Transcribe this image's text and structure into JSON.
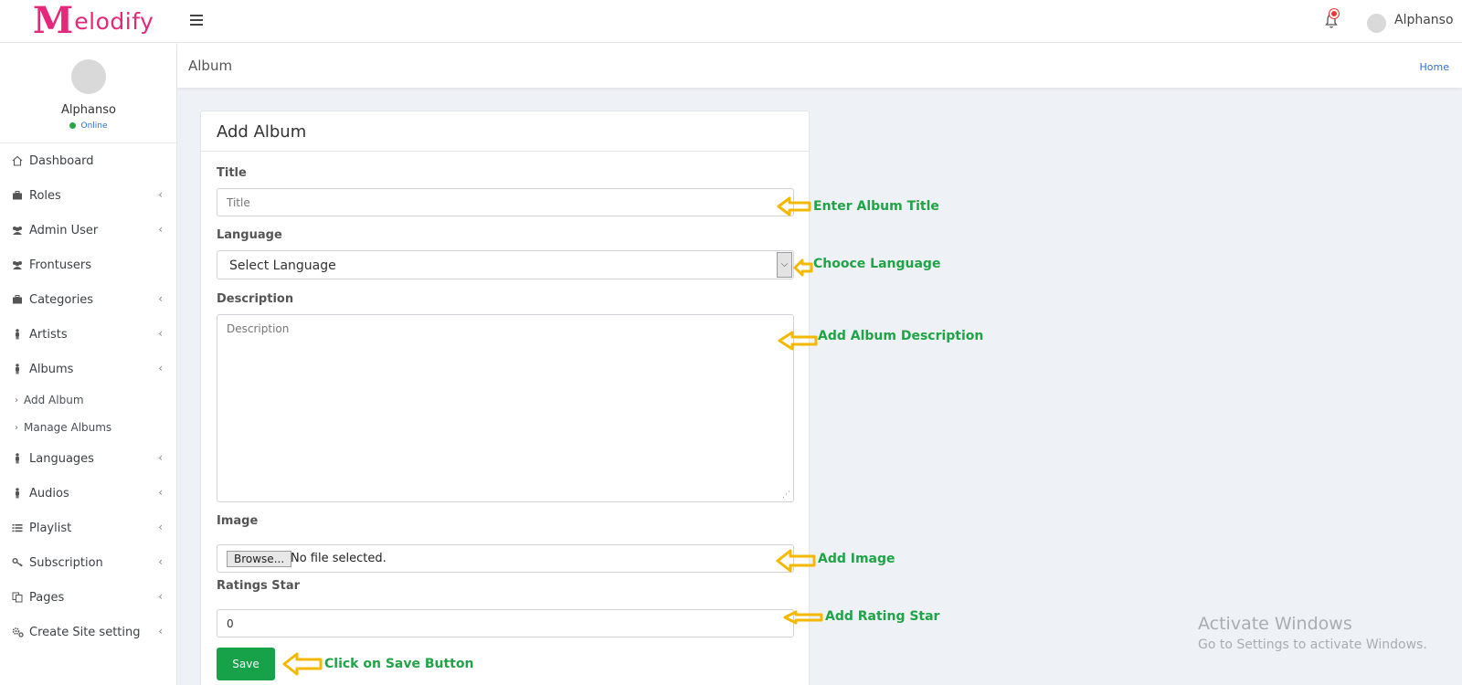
{
  "header": {
    "logo_first": "M",
    "logo_rest": "elodify",
    "user_name": "Alphanso"
  },
  "sidebar": {
    "profile_name": "Alphanso",
    "profile_status": "Online",
    "items": [
      {
        "label": "Dashboard",
        "icon": "home-icon"
      },
      {
        "label": "Roles",
        "icon": "briefcase-icon"
      },
      {
        "label": "Admin User",
        "icon": "users-icon"
      },
      {
        "label": "Frontusers",
        "icon": "users-icon"
      },
      {
        "label": "Categories",
        "icon": "briefcase-icon"
      },
      {
        "label": "Artists",
        "icon": "person-icon"
      },
      {
        "label": "Albums",
        "icon": "person-icon"
      },
      {
        "label": "Languages",
        "icon": "person-icon"
      },
      {
        "label": "Audios",
        "icon": "person-icon"
      },
      {
        "label": "Playlist",
        "icon": "list-icon"
      },
      {
        "label": "Subscription",
        "icon": "key-icon"
      },
      {
        "label": "Pages",
        "icon": "copy-icon"
      },
      {
        "label": "Create Site setting",
        "icon": "gears-icon"
      }
    ],
    "albums_sub": [
      "Add Album",
      "Manage Albums"
    ]
  },
  "content_header": {
    "title": "Album",
    "breadcrumb": "Home"
  },
  "form": {
    "card_title": "Add Album",
    "title_label": "Title",
    "title_placeholder": "Title",
    "language_label": "Language",
    "language_value": "Select Language",
    "description_label": "Description",
    "description_placeholder": "Description",
    "image_label": "Image",
    "browse_label": "Browse...",
    "no_file": "No file selected.",
    "ratings_label": "Ratings Star",
    "ratings_value": "0",
    "save_label": "Save"
  },
  "annotations": {
    "title": "Enter Album Title",
    "language": "Chooce Language",
    "description": "Add Album Description",
    "image": "Add Image",
    "rating": "Add Rating Star",
    "save": "Click on Save Button"
  },
  "colors": {
    "brand": "#e6287a",
    "save_button": "#17a24a",
    "annotation_text": "#21a347",
    "annotation_arrow": "#f5b800",
    "link": "#2f6fcf"
  },
  "watermark": {
    "line1": "Activate Windows",
    "line2": "Go to Settings to activate Windows."
  }
}
